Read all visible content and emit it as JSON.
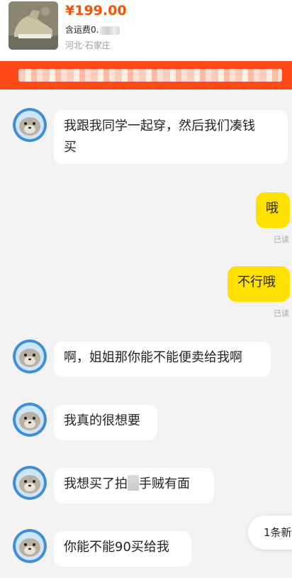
{
  "product": {
    "price": "¥199.00",
    "shipping": "含运费0.",
    "location": "河北·石家庄",
    "image_icon": "sneaker-photo-icon"
  },
  "notice_banner": {
    "text": ""
  },
  "messages": [
    {
      "from": "them",
      "text": "我跟我同学一起穿，然后我们凑钱",
      "text2": "买"
    },
    {
      "from": "me",
      "text": "哦",
      "status": "已读"
    },
    {
      "from": "me",
      "text": "不行哦",
      "status": "已读"
    },
    {
      "from": "them",
      "text": "啊，姐姐那你能不能便卖给我啊"
    },
    {
      "from": "them",
      "text": "我真的很想要"
    },
    {
      "from": "them",
      "text_a": "我想买了拍",
      "text_b": "手贼有面"
    },
    {
      "from": "them",
      "text": "你能不能90买给我"
    }
  ],
  "new_messages_pill": "1条新",
  "colors": {
    "accent": "#ff5000",
    "banner": "#ff4a17",
    "my_bubble": "#ffe100"
  },
  "avatar_icon": "seal-avatar-icon"
}
